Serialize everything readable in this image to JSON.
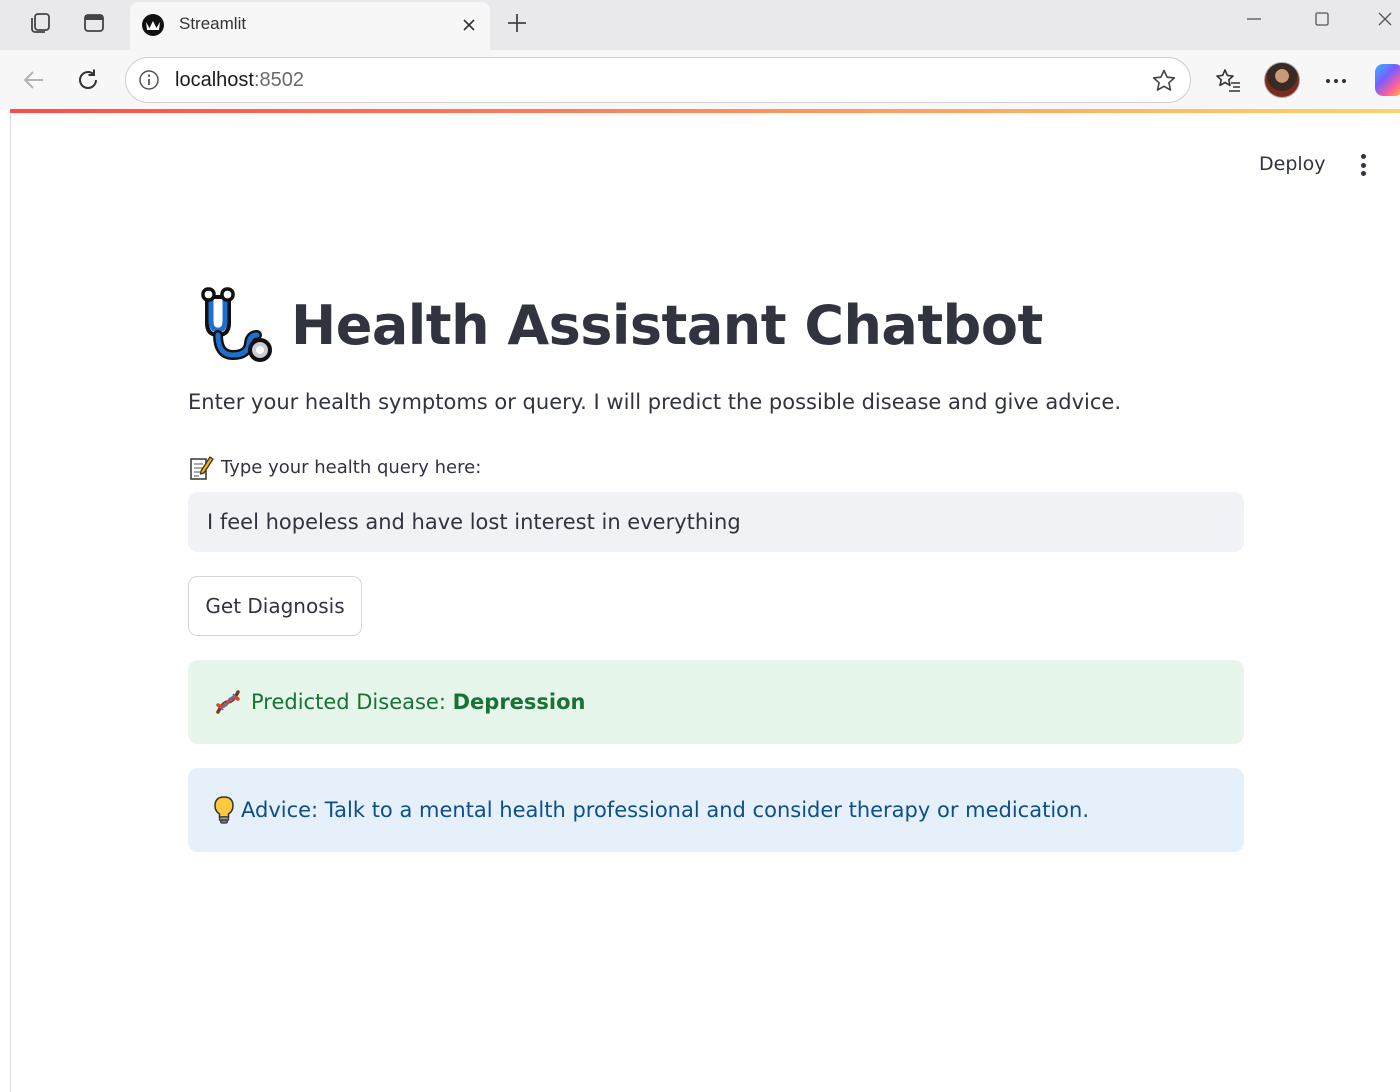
{
  "browser": {
    "tab_title": "Streamlit",
    "url_host": "localhost",
    "url_port": ":8502"
  },
  "toolbar": {
    "deploy_label": "Deploy"
  },
  "app": {
    "title": "Health Assistant Chatbot",
    "title_icon": "stethoscope-emoji",
    "subtitle": "Enter your health symptoms or query. I will predict the possible disease and give advice.",
    "input_label": "Type your health query here:",
    "input_label_icon": "memo-emoji",
    "input_value": "I feel hopeless and have lost interest in everything",
    "button_label": "Get Diagnosis",
    "prediction_prefix": "Predicted Disease: ",
    "prediction_value": "Depression",
    "prediction_icon": "dna-emoji",
    "advice_text": "Advice: Talk to a mental health professional and consider therapy or medication.",
    "advice_icon": "light-bulb-emoji"
  },
  "colors": {
    "text": "#31333f",
    "input_bg": "#f0f2f6",
    "success_bg": "#e6f6ea",
    "success_text": "#177233",
    "info_bg": "#e5f0fb",
    "info_text": "#0e4f88",
    "accent": "#ff4b4b"
  }
}
